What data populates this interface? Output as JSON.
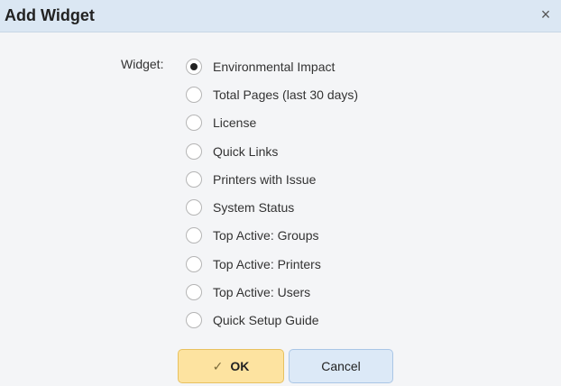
{
  "dialog": {
    "title": "Add Widget",
    "close_glyph": "×"
  },
  "form": {
    "field_label": "Widget:",
    "selected_index": 0,
    "options": [
      "Environmental Impact",
      "Total Pages (last 30 days)",
      "License",
      "Quick Links",
      "Printers with Issue",
      "System Status",
      "Top Active: Groups",
      "Top Active: Printers",
      "Top Active: Users",
      "Quick Setup Guide"
    ]
  },
  "buttons": {
    "ok_icon": "✓",
    "ok_label": "OK",
    "cancel_label": "Cancel"
  },
  "icons": {
    "close": "close-icon",
    "ok": "checkmark-icon"
  },
  "colors": {
    "titlebar_bg": "#dbe7f3",
    "ok_bg": "#fde3a0",
    "cancel_bg": "#dce9f7"
  }
}
